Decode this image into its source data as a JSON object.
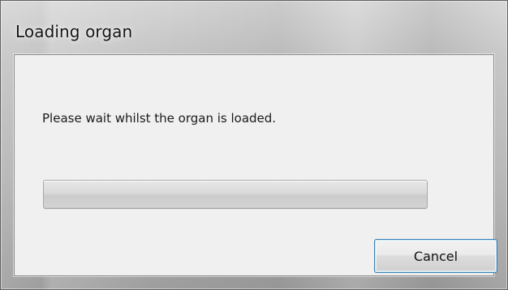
{
  "window": {
    "title": "Loading organ"
  },
  "dialog": {
    "message": "Please wait whilst the organ is loaded.",
    "progress": 0,
    "cancel_label": "Cancel"
  }
}
